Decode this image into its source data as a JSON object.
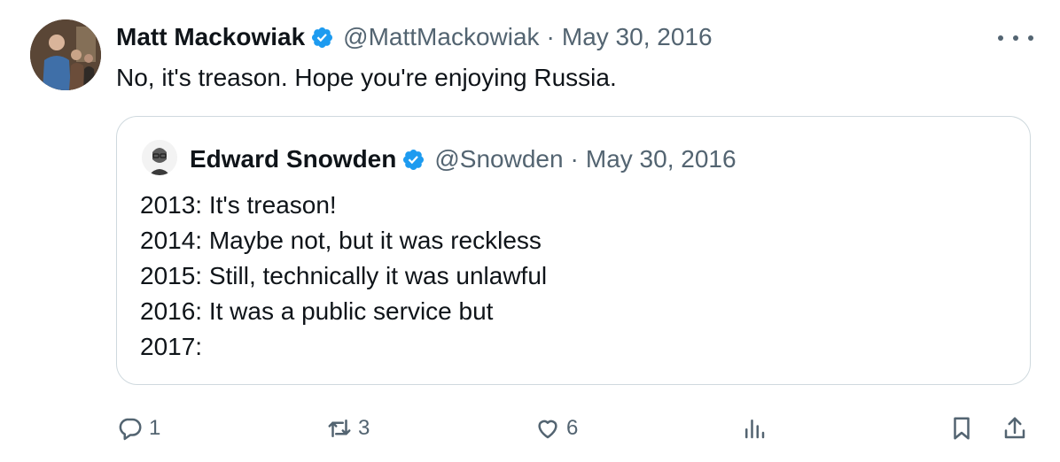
{
  "tweet": {
    "author_name": "Matt Mackowiak",
    "handle": "@MattMackowiak",
    "separator": "·",
    "date": "May 30, 2016",
    "text": "No, it's treason. Hope you're enjoying Russia."
  },
  "quoted": {
    "author_name": "Edward Snowden",
    "handle": "@Snowden",
    "separator": "·",
    "date": "May 30, 2016",
    "lines": [
      "2013: It's treason!",
      "2014: Maybe not, but it was reckless",
      "2015: Still, technically it was unlawful",
      "2016: It was a public service but",
      "2017:"
    ]
  },
  "actions": {
    "replies": "1",
    "retweets": "3",
    "likes": "6"
  },
  "colors": {
    "verified": "#1d9bf0",
    "secondary_text": "#536471",
    "border": "#cfd9de"
  },
  "icons": [
    "verified-badge-icon",
    "more-icon",
    "reply-icon",
    "retweet-icon",
    "like-icon",
    "views-icon",
    "bookmark-icon",
    "share-icon"
  ]
}
